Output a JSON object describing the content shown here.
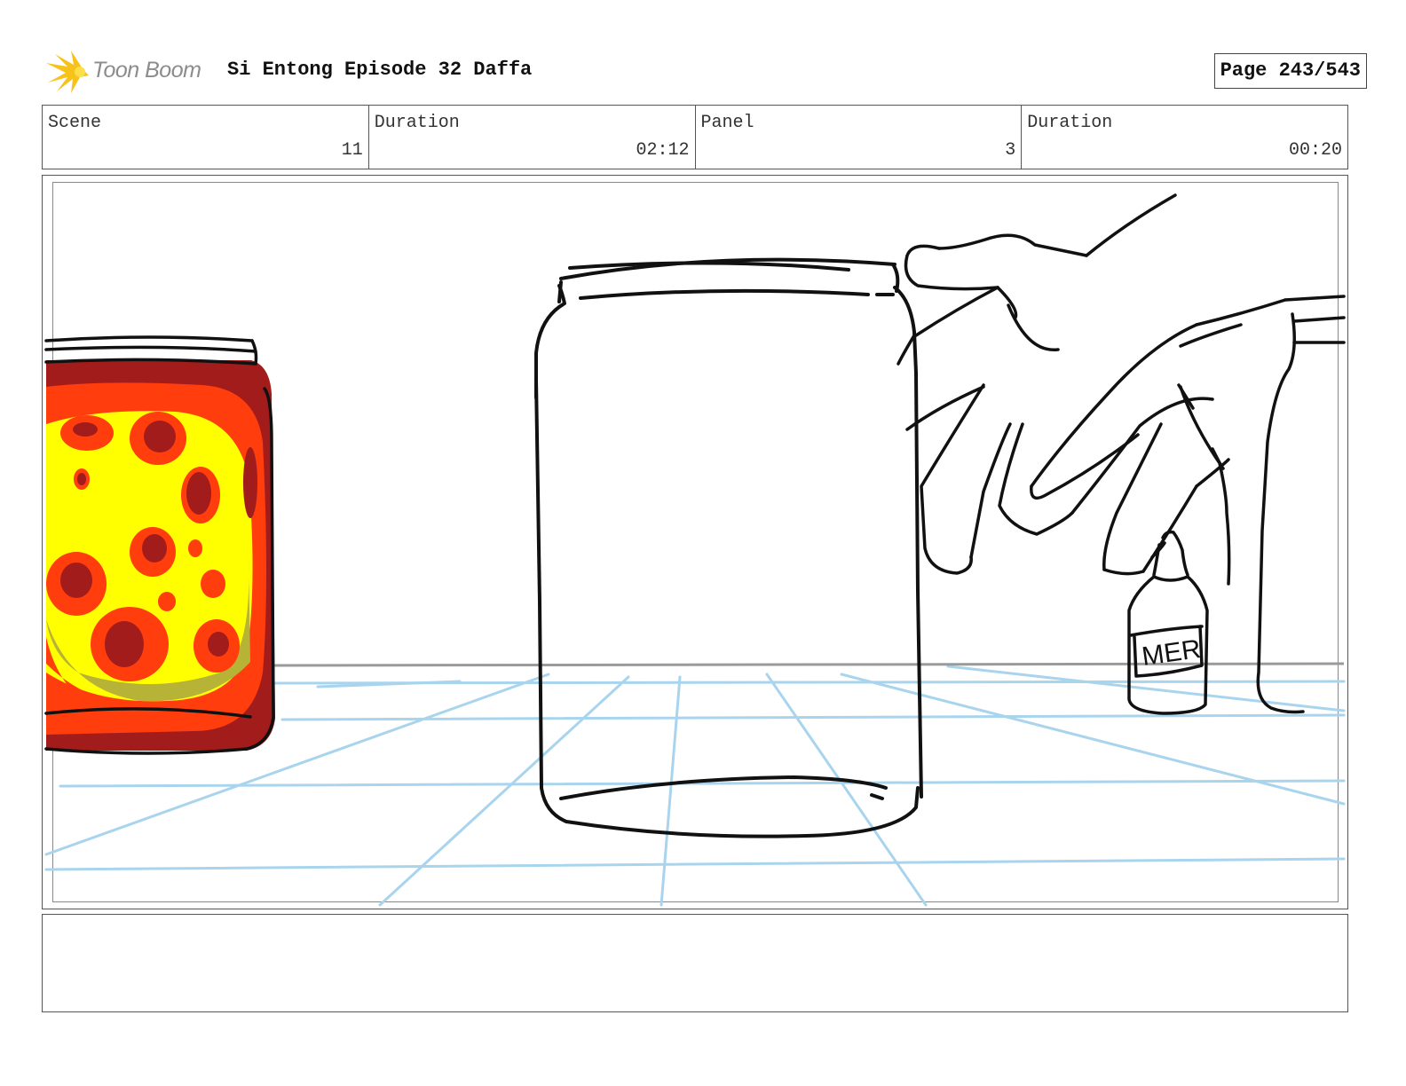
{
  "header": {
    "logo_text": "Toon Boom",
    "title": "Si Entong Episode 32 Daffa",
    "page": "Page 243/543"
  },
  "info": {
    "scene_label": "Scene",
    "scene_value": "11",
    "duration_label": "Duration",
    "duration_value": "02:12",
    "panel_label": "Panel",
    "panel_value": "3",
    "panel_duration_label": "Duration",
    "panel_duration_value": "00:20"
  },
  "panel": {
    "bottle_label": "MER",
    "colors": {
      "sketch_line": "#111111",
      "guide_blue": "#a9d4ee",
      "jar_dark_red": "#a31c1c",
      "jar_orange": "#ff3d0d",
      "jar_yellow": "#ffff00",
      "jar_olive": "#b7b336"
    }
  },
  "notes": {
    "text": ""
  }
}
